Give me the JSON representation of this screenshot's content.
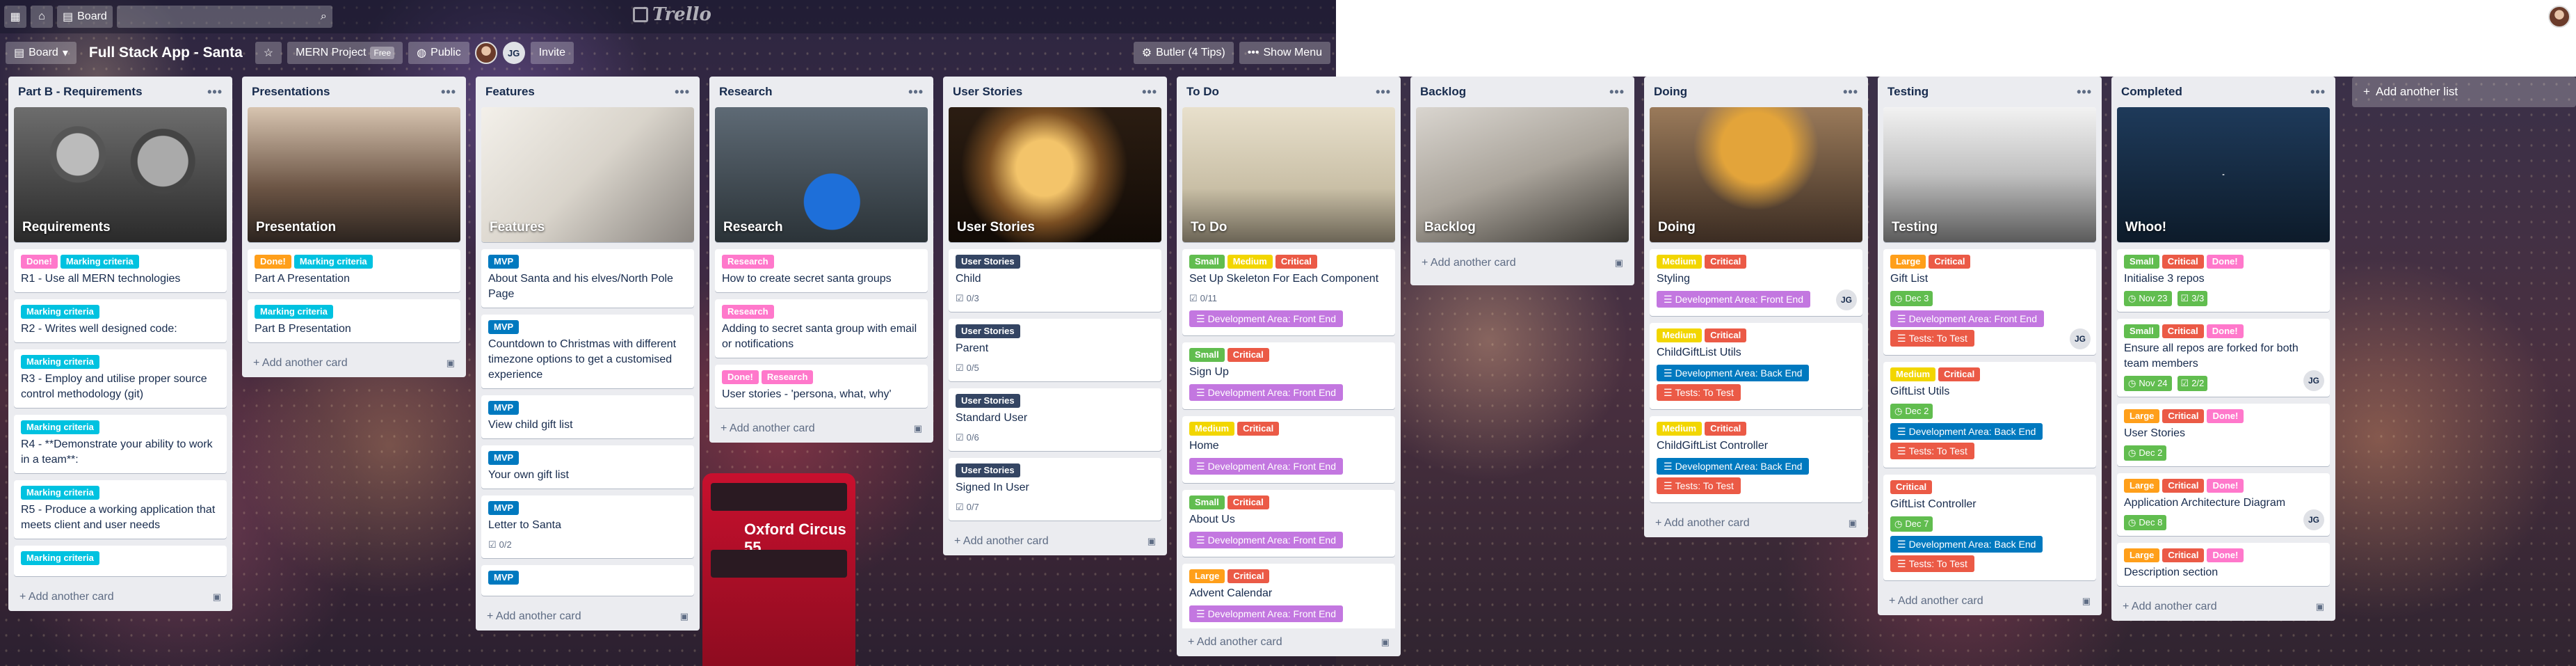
{
  "topbar": {
    "boards": "Board",
    "search_icon": "search-icon",
    "logo": "Trello"
  },
  "header": {
    "board_switch": "Board",
    "title": "Full Stack App - Santa",
    "team": "MERN Project",
    "free": "Free",
    "visibility": "Public",
    "member_initials": "JG",
    "invite": "Invite",
    "butler": "Butler (4 Tips)",
    "menu": "Show Menu"
  },
  "colors": {
    "green": "#61bd4f",
    "yellow": "#f2d600",
    "orange": "#ff9f1a",
    "red": "#eb5a46",
    "purple": "#c377e0",
    "blue": "#0079bf",
    "sky": "#00c2e0",
    "pink": "#ff78cb",
    "black": "#344563"
  },
  "lists": [
    {
      "title": "Part B - Requirements",
      "add": "Add another card",
      "cover_label": "Requirements",
      "cards": [
        {
          "labels": [
            [
              "Done!",
              "pink"
            ],
            [
              "Marking criteria",
              "sky"
            ]
          ],
          "text": "R1 - Use all MERN technologies"
        },
        {
          "labels": [
            [
              "Marking criteria",
              "sky"
            ]
          ],
          "text": "R2 - Writes well designed code:"
        },
        {
          "labels": [
            [
              "Marking criteria",
              "sky"
            ]
          ],
          "text": "R3 - Employ and utilise proper source control methodology (git)"
        },
        {
          "labels": [
            [
              "Marking criteria",
              "sky"
            ]
          ],
          "text": "R4 - **Demonstrate your ability to work in a team**:"
        },
        {
          "labels": [
            [
              "Marking criteria",
              "sky"
            ]
          ],
          "text": "R5 - Produce a working application that meets client and user needs"
        },
        {
          "labels": [
            [
              "Marking criteria",
              "sky"
            ]
          ],
          "text": ""
        }
      ]
    },
    {
      "title": "Presentations",
      "add": "Add another card",
      "cover_label": "Presentation",
      "cards": [
        {
          "labels": [
            [
              "Done!",
              "orange"
            ],
            [
              "Marking criteria",
              "sky"
            ]
          ],
          "text": "Part A Presentation"
        },
        {
          "labels": [
            [
              "Marking criteria",
              "sky"
            ]
          ],
          "text": "Part B Presentation"
        }
      ]
    },
    {
      "title": "Features",
      "add": "Add another card",
      "cover_label": "Features",
      "cards": [
        {
          "labels": [
            [
              "MVP",
              "blue"
            ]
          ],
          "text": "About Santa and his elves/North Pole Page"
        },
        {
          "labels": [
            [
              "MVP",
              "blue"
            ]
          ],
          "text": "Countdown to Christmas with different timezone options to get a customised experience"
        },
        {
          "labels": [
            [
              "MVP",
              "blue"
            ]
          ],
          "text": "View child gift list"
        },
        {
          "labels": [
            [
              "MVP",
              "blue"
            ]
          ],
          "text": "Your own gift list"
        },
        {
          "labels": [
            [
              "MVP",
              "blue"
            ]
          ],
          "text": "Letter to Santa",
          "check": "0/2"
        },
        {
          "labels": [
            [
              "MVP",
              "blue"
            ]
          ],
          "text": ""
        }
      ]
    },
    {
      "title": "Research",
      "add": "Add another card",
      "cover_label": "Research",
      "cards": [
        {
          "labels": [
            [
              "Research",
              "pink"
            ]
          ],
          "text": "How to create secret santa groups"
        },
        {
          "labels": [
            [
              "Research",
              "pink"
            ]
          ],
          "text": "Adding to secret santa group with email or notifications"
        },
        {
          "labels": [
            [
              "Done!",
              "pink"
            ],
            [
              "Research",
              "pink"
            ]
          ],
          "text": "User stories - 'persona, what, why'"
        }
      ]
    },
    {
      "title": "User Stories",
      "add": "Add another card",
      "cover_label": "User Stories",
      "cards": [
        {
          "labels": [
            [
              "User Stories",
              "black"
            ]
          ],
          "text": "Child",
          "check": "0/3"
        },
        {
          "labels": [
            [
              "User Stories",
              "black"
            ]
          ],
          "text": "Parent",
          "check": "0/5"
        },
        {
          "labels": [
            [
              "User Stories",
              "black"
            ]
          ],
          "text": "Standard User",
          "check": "0/6"
        },
        {
          "labels": [
            [
              "User Stories",
              "black"
            ]
          ],
          "text": "Signed In User",
          "check": "0/7"
        }
      ]
    },
    {
      "title": "To Do",
      "add": "Add another card",
      "cover_label": "To Do",
      "cards": [
        {
          "labels": [
            [
              "Small",
              "green"
            ],
            [
              "Medium",
              "yellow"
            ],
            [
              "Critical",
              "red"
            ]
          ],
          "text": "Set Up Skeleton For Each Component",
          "check": "0/11",
          "area": [
            [
              "Development Area: Front End",
              "purple"
            ]
          ]
        },
        {
          "labels": [
            [
              "Small",
              "green"
            ],
            [
              "Critical",
              "red"
            ]
          ],
          "text": "Sign Up",
          "area": [
            [
              "Development Area: Front End",
              "purple"
            ]
          ]
        },
        {
          "labels": [
            [
              "Medium",
              "yellow"
            ],
            [
              "Critical",
              "red"
            ]
          ],
          "text": "Home",
          "area": [
            [
              "Development Area: Front End",
              "purple"
            ]
          ]
        },
        {
          "labels": [
            [
              "Small",
              "green"
            ],
            [
              "Critical",
              "red"
            ]
          ],
          "text": "About Us",
          "area": [
            [
              "Development Area: Front End",
              "purple"
            ]
          ]
        },
        {
          "labels": [
            [
              "Large",
              "orange"
            ],
            [
              "Critical",
              "red"
            ]
          ],
          "text": "Advent Calendar",
          "area": [
            [
              "Development Area: Front End",
              "purple"
            ]
          ]
        }
      ]
    },
    {
      "title": "Backlog",
      "add": "Add another card",
      "cover_label": "Backlog",
      "cards": []
    },
    {
      "title": "Doing",
      "add": "Add another card",
      "cover_label": "Doing",
      "cards": [
        {
          "labels": [
            [
              "Medium",
              "yellow"
            ],
            [
              "Critical",
              "red"
            ]
          ],
          "text": "Styling",
          "area": [
            [
              "Development Area: Front End",
              "purple"
            ]
          ],
          "member": "JG"
        },
        {
          "labels": [
            [
              "Medium",
              "yellow"
            ],
            [
              "Critical",
              "red"
            ]
          ],
          "text": "ChildGiftList Utils",
          "area": [
            [
              "Development Area: Back End",
              "blue"
            ],
            [
              "Tests: To Test",
              "red"
            ]
          ]
        },
        {
          "labels": [
            [
              "Medium",
              "yellow"
            ],
            [
              "Critical",
              "red"
            ]
          ],
          "text": "ChildGiftList Controller",
          "area": [
            [
              "Development Area: Back End",
              "blue"
            ],
            [
              "Tests: To Test",
              "red"
            ]
          ]
        }
      ]
    },
    {
      "title": "Testing",
      "add": "Add another card",
      "cover_label": "Testing",
      "cards": [
        {
          "labels": [
            [
              "Large",
              "orange"
            ],
            [
              "Critical",
              "red"
            ]
          ],
          "text": "Gift List",
          "due": "Dec 3",
          "area": [
            [
              "Development Area: Front End",
              "purple"
            ],
            [
              "Tests: To Test",
              "red"
            ]
          ],
          "member": "JG"
        },
        {
          "labels": [
            [
              "Medium",
              "yellow"
            ],
            [
              "Critical",
              "red"
            ]
          ],
          "text": "GiftList Utils",
          "due": "Dec 2",
          "area": [
            [
              "Development Area: Back End",
              "blue"
            ],
            [
              "Tests: To Test",
              "red"
            ]
          ]
        },
        {
          "labels": [
            [
              "Critical",
              "red"
            ]
          ],
          "text": "GiftList Controller",
          "due": "Dec 7",
          "area": [
            [
              "Development Area: Back End",
              "blue"
            ],
            [
              "Tests: To Test",
              "red"
            ]
          ]
        }
      ]
    },
    {
      "title": "Completed",
      "add": "Add another card",
      "cover_label": "Whoo!",
      "cards": [
        {
          "labels": [
            [
              "Small",
              "green"
            ],
            [
              "Critical",
              "red"
            ],
            [
              "Done!",
              "pink"
            ]
          ],
          "text": "Initialise 3 repos",
          "due": "Nov 23",
          "check": "3/3"
        },
        {
          "labels": [
            [
              "Small",
              "green"
            ],
            [
              "Critical",
              "red"
            ],
            [
              "Done!",
              "pink"
            ]
          ],
          "text": "Ensure all repos are forked for both team members",
          "due": "Nov 24",
          "check": "2/2",
          "member": "JG"
        },
        {
          "labels": [
            [
              "Large",
              "orange"
            ],
            [
              "Critical",
              "red"
            ],
            [
              "Done!",
              "pink"
            ]
          ],
          "text": "User Stories",
          "due": "Dec 2"
        },
        {
          "labels": [
            [
              "Large",
              "orange"
            ],
            [
              "Critical",
              "red"
            ],
            [
              "Done!",
              "pink"
            ]
          ],
          "text": "Application Architecture Diagram",
          "due": "Dec 8",
          "member": "JG"
        },
        {
          "labels": [
            [
              "Large",
              "orange"
            ],
            [
              "Critical",
              "red"
            ],
            [
              "Done!",
              "pink"
            ]
          ],
          "text": "Description section"
        }
      ]
    }
  ],
  "add_list": "Add another list"
}
